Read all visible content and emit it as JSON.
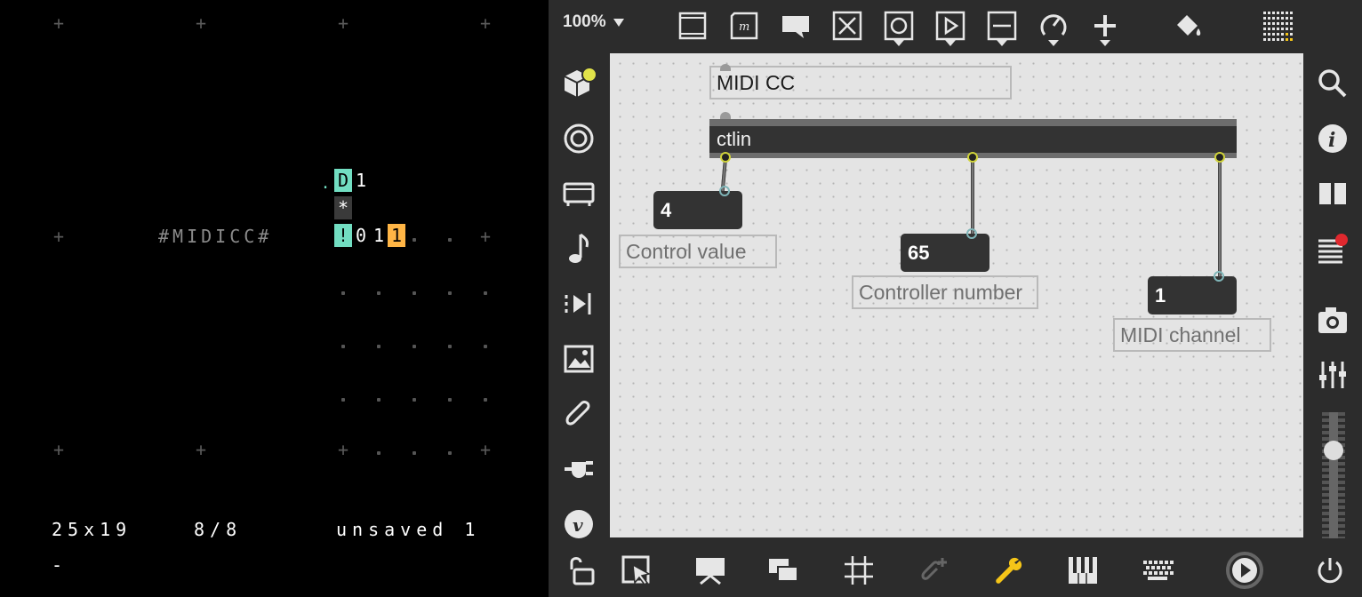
{
  "orca": {
    "comment": "#MIDICC#",
    "ops": {
      "dot": ".",
      "d": "D",
      "one_top": "1",
      "star": "*",
      "bang": "!",
      "c0": "0",
      "c1": "1",
      "c2": "1"
    },
    "status": {
      "grid_size": "25x19",
      "frame": "8/8",
      "file": "unsaved 1",
      "cursor": "-"
    },
    "colors": {
      "cyan": "#72dec2",
      "orange": "#ffb545"
    }
  },
  "max": {
    "zoom": "100%",
    "top_toolbar_icons": [
      "presentation-icon",
      "message-icon",
      "comment-icon",
      "toggle-icon",
      "button-icon",
      "play-icon",
      "slider-icon",
      "dial-icon",
      "add-icon",
      "paint-bucket-icon",
      "grid-matrix-icon"
    ],
    "left_sidebar_icons": [
      "package-icon",
      "target-icon",
      "video-icon",
      "music-note-icon",
      "step-forward-icon",
      "image-icon",
      "paperclip-icon",
      "plug-icon",
      "vimeo-icon",
      "unlock-icon"
    ],
    "right_sidebar_icons": [
      "search-icon",
      "info-icon",
      "split-view-icon",
      "console-icon",
      "snapshot-icon",
      "mixer-icon"
    ],
    "bottom_toolbar_icons": [
      "edit-select-icon",
      "presentation-mode-icon",
      "windows-icon",
      "grid-icon",
      "attach-icon",
      "wrench-icon",
      "piano-icon",
      "keyboard-icon",
      "play-circle-icon",
      "power-icon"
    ],
    "patch": {
      "title_comment": "MIDI CC",
      "object_name": "ctlin",
      "number_boxes": [
        {
          "value": "4",
          "label": "Control value"
        },
        {
          "value": "65",
          "label": "Controller number"
        },
        {
          "value": "1",
          "label": "MIDI channel"
        }
      ]
    },
    "accent_colors": {
      "notification": "#e0282e",
      "yellow_dot": "#e1e34a",
      "wrench": "#f5c518"
    }
  }
}
